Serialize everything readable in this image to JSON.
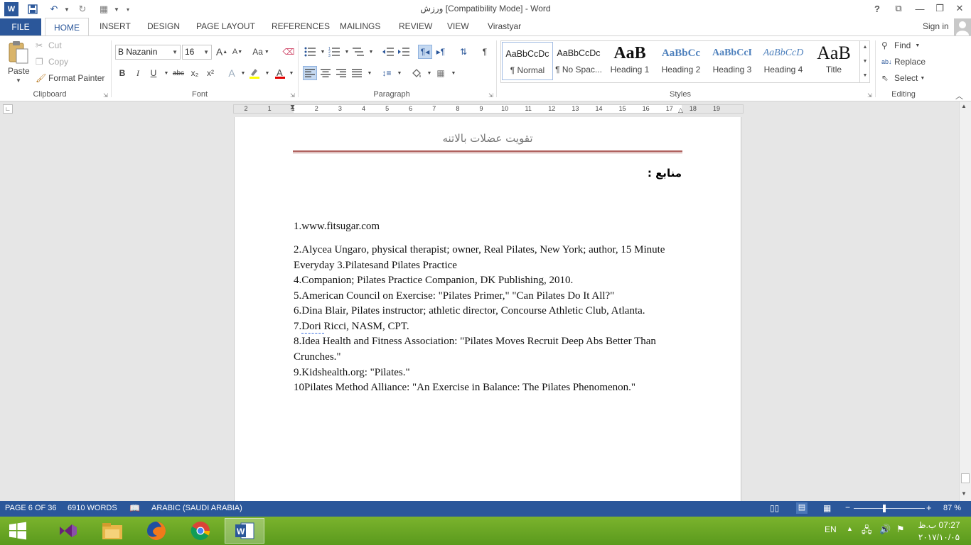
{
  "window": {
    "title": "ورزش [Compatibility Mode] - Word"
  },
  "tabs": {
    "file": "FILE",
    "home": "HOME",
    "insert": "INSERT",
    "design": "DESIGN",
    "page_layout": "PAGE LAYOUT",
    "references": "REFERENCES",
    "mailings": "MAILINGS",
    "review": "REVIEW",
    "view": "VIEW",
    "virastyar": "Virastyar",
    "sign_in": "Sign in"
  },
  "clipboard": {
    "paste": "Paste",
    "cut": "Cut",
    "copy": "Copy",
    "format_painter": "Format Painter",
    "label": "Clipboard"
  },
  "font": {
    "name": "B Nazanin",
    "size": "16",
    "label": "Font",
    "grow": "A",
    "shrink": "A",
    "case": "Aa",
    "bold": "B",
    "italic": "I",
    "underline": "U",
    "strike": "abc",
    "sub": "x₂",
    "sup": "x²"
  },
  "paragraph": {
    "label": "Paragraph",
    "pilcrow": "¶"
  },
  "styles": {
    "label": "Styles",
    "items": [
      {
        "preview": "AaBbCcDc",
        "name": "¶ Normal"
      },
      {
        "preview": "AaBbCcDc",
        "name": "¶ No Spac..."
      },
      {
        "preview": "AaB",
        "name": "Heading 1"
      },
      {
        "preview": "AaBbCc",
        "name": "Heading 2"
      },
      {
        "preview": "AaBbCcI",
        "name": "Heading 3"
      },
      {
        "preview": "AaBbCcD",
        "name": "Heading 4"
      },
      {
        "preview": "AaB",
        "name": "Title"
      }
    ]
  },
  "editing": {
    "label": "Editing",
    "find": "Find",
    "replace": "Replace",
    "select": "Select"
  },
  "ruler": {
    "numbers": [
      "2",
      "1",
      "1",
      "2",
      "3",
      "4",
      "5",
      "6",
      "7",
      "8",
      "9",
      "10",
      "11",
      "12",
      "13",
      "14",
      "15",
      "16",
      "17",
      "18",
      "19"
    ]
  },
  "document": {
    "header": "تقویت عضلات بالاتنه",
    "heading": "منابع :",
    "references": [
      "1.www.fitsugar.com",
      "2.Alycea Ungaro, physical therapist; owner, Real Pilates, New York; author, 15 Minute Everyday 3.Pilatesand Pilates Practice",
      "4.Companion; Pilates Practice Companion, DK Publishing, 2010.",
      "5.American Council on Exercise: \"Pilates Primer,\" \"Can Pilates Do It All?\"",
      "6.Dina Blair, Pilates instructor; athletic director, Concourse Athletic Club, Atlanta.",
      "7.Dori Ricci, NASM, CPT.",
      "8.Idea Health and Fitness Association: \"Pilates Moves Recruit Deep Abs Better Than Crunches.\"",
      "9.Kidshealth.org: \"Pilates.\"",
      "10Pilates Method Alliance: \"An Exercise in Balance: The Pilates Phenomenon.\""
    ]
  },
  "status": {
    "page": "PAGE 6 OF 36",
    "words": "6910 WORDS",
    "language": "ARABIC (SAUDI ARABIA)",
    "zoom": "87 %"
  },
  "taskbar": {
    "lang": "EN",
    "time": "07:27 ب.ظ",
    "date": "۲۰۱۷/۱۰/۰۵"
  },
  "colors": {
    "word_blue": "#2b579a",
    "taskbar_green": "#6aa825"
  }
}
